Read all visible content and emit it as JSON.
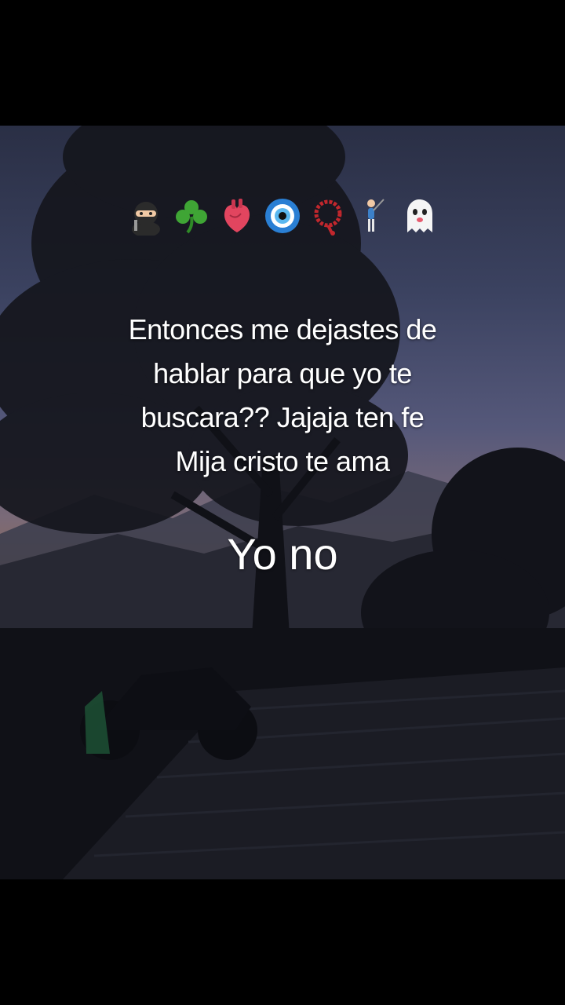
{
  "overlay": {
    "emojis": [
      "ninja",
      "shamrock",
      "anatomical-heart",
      "nazar-amulet",
      "prayer-beads",
      "person-golfing",
      "ghost"
    ],
    "caption_lines": [
      "Entonces me dejastes de",
      "hablar para que yo te",
      "buscara?? Jajaja ten fe",
      "Mija cristo te ama"
    ],
    "reply": "Yo no"
  },
  "colors": {
    "background": "#000000",
    "text": "#ffffff"
  }
}
